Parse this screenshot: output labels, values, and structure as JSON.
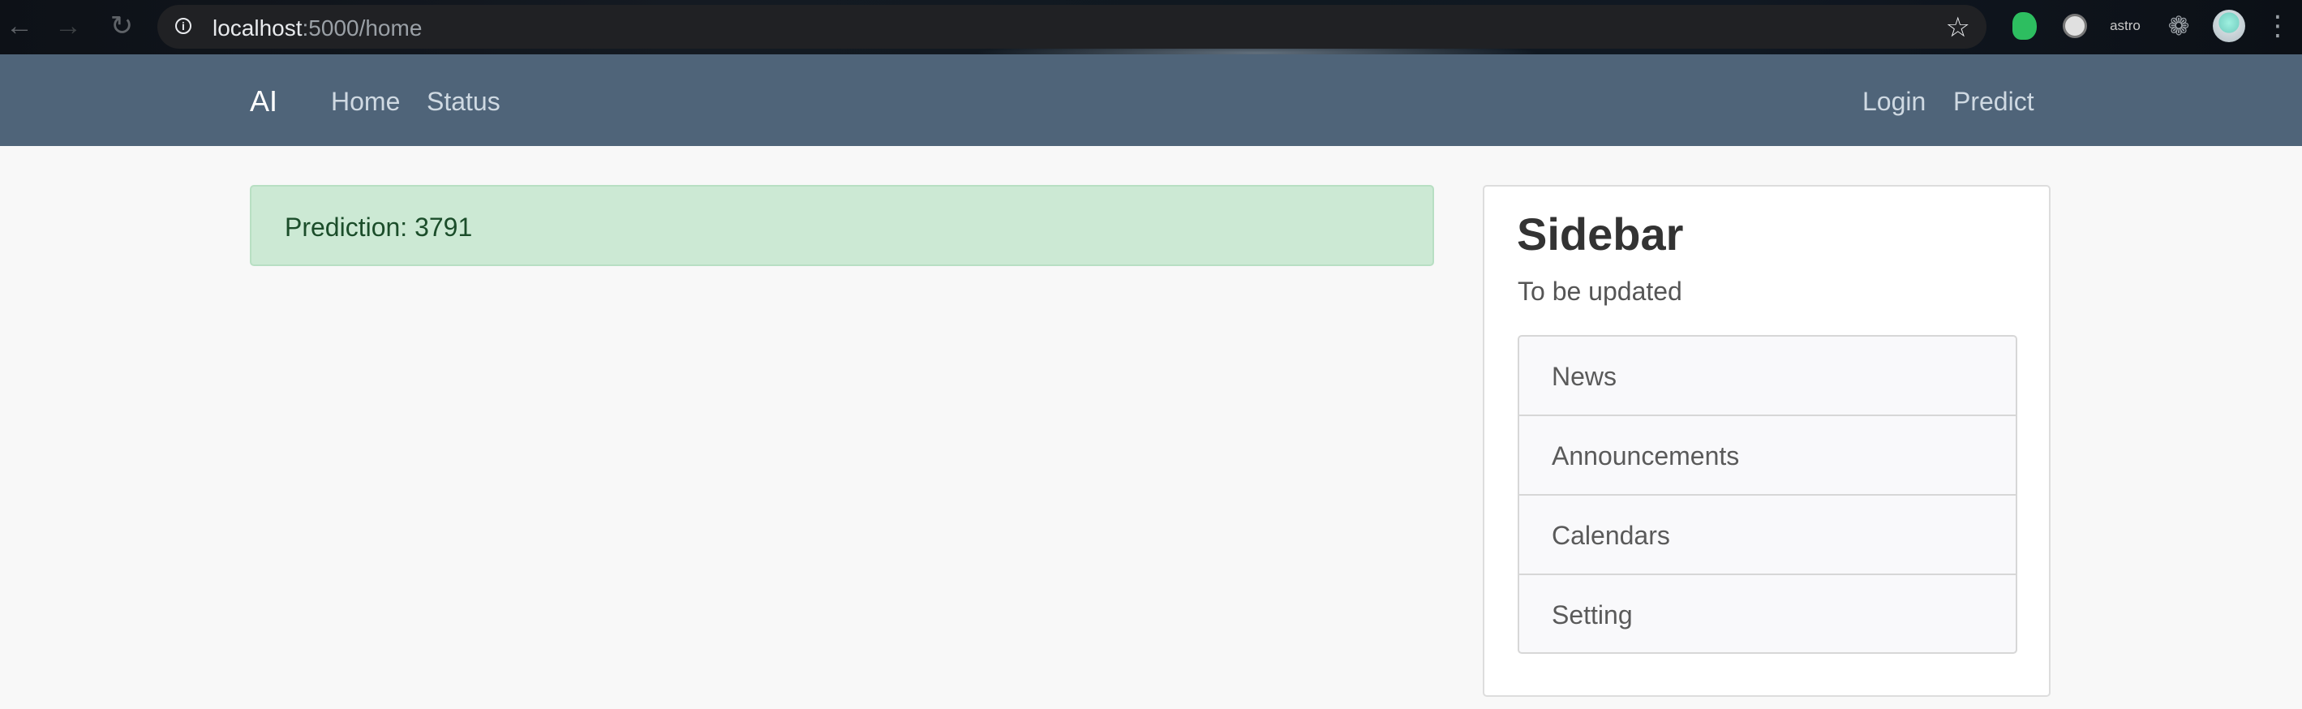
{
  "browser": {
    "url_host": "localhost",
    "url_path": ":5000/home",
    "extensions": {
      "astro_label": "astro"
    }
  },
  "navbar": {
    "brand": "AI",
    "links_left": [
      "Home",
      "Status"
    ],
    "links_right": [
      "Login",
      "Predict"
    ],
    "background": "#4f6479"
  },
  "alert": {
    "text": "Prediction: 3791",
    "background": "#cce9d4"
  },
  "sidebar": {
    "title": "Sidebar",
    "subtitle": "To be updated",
    "items": [
      {
        "label": "News"
      },
      {
        "label": "Announcements"
      },
      {
        "label": "Calendars"
      },
      {
        "label": "Setting"
      }
    ]
  },
  "icons": [
    "back-arrow-icon",
    "forward-arrow-icon",
    "reload-icon",
    "info-icon",
    "star-icon",
    "evernote-icon",
    "film-reel-icon",
    "astro-icon",
    "puzzle-icon",
    "profile-avatar-icon",
    "kebab-menu-icon"
  ]
}
